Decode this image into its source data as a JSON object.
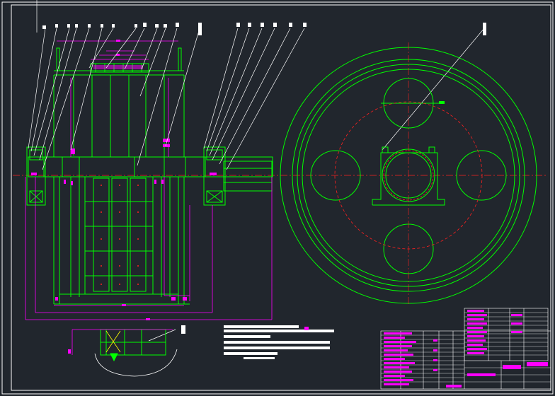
{
  "drawing": {
    "title_block_visible": true,
    "notes_visible": true
  },
  "colors": {
    "background": "#21262d",
    "frame": "#ffffff",
    "outline": "#00ff00",
    "dimension": "#ff00ff",
    "centerline": "#ff2020",
    "leader": "#ffffff",
    "highlight": "#ffff00"
  },
  "views": {
    "front_section": "front-section-view",
    "side_view": "side-view",
    "detail_view": "detail-view"
  }
}
